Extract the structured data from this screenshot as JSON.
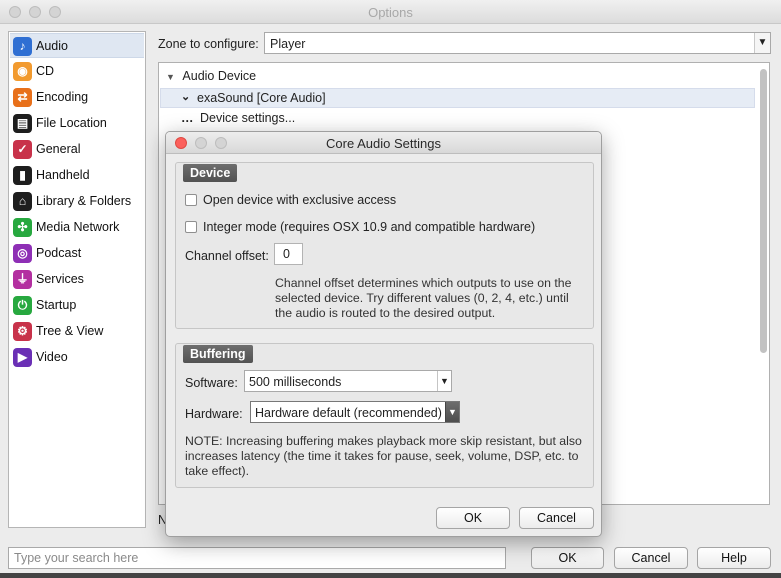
{
  "window": {
    "title": "Options"
  },
  "sidebar": {
    "items": [
      {
        "label": "Audio",
        "icon": "music-note-icon",
        "glyph": "♪",
        "color": "#2f6fd3",
        "selected": true
      },
      {
        "label": "CD",
        "icon": "cd-icon",
        "glyph": "◉",
        "color": "#f29a2e"
      },
      {
        "label": "Encoding",
        "icon": "encoding-arrows-icon",
        "glyph": "⇄",
        "color": "#e8701a"
      },
      {
        "label": "File Location",
        "icon": "file-location-icon",
        "glyph": "▤",
        "color": "#1e1e1e"
      },
      {
        "label": "General",
        "icon": "checkmark-icon",
        "glyph": "✓",
        "color": "#c8324a"
      },
      {
        "label": "Handheld",
        "icon": "handheld-icon",
        "glyph": "▮",
        "color": "#1e1e1e"
      },
      {
        "label": "Library & Folders",
        "icon": "library-house-icon",
        "glyph": "⌂",
        "color": "#1e1e1e"
      },
      {
        "label": "Media Network",
        "icon": "media-network-icon",
        "glyph": "✣",
        "color": "#27a83f"
      },
      {
        "label": "Podcast",
        "icon": "podcast-icon",
        "glyph": "◎",
        "color": "#8e2fb5"
      },
      {
        "label": "Services",
        "icon": "plug-icon",
        "glyph": "⏚",
        "color": "#b32fa0"
      },
      {
        "label": "Startup",
        "icon": "power-icon",
        "glyph": "⏻",
        "color": "#27a83f"
      },
      {
        "label": "Tree & View",
        "icon": "gear-icon",
        "glyph": "⚙",
        "color": "#c8324a"
      },
      {
        "label": "Video",
        "icon": "video-camera-icon",
        "glyph": "▶",
        "color": "#6a2fb5"
      }
    ]
  },
  "zone": {
    "label": "Zone to configure:",
    "value": "Player"
  },
  "tree": {
    "section": "Audio Device",
    "device": "exaSound [Core Audio]",
    "settings_link": "Device settings...",
    "clipped_text": "N"
  },
  "search": {
    "placeholder": "Type your search here"
  },
  "buttons": {
    "ok": "OK",
    "cancel": "Cancel",
    "help": "Help"
  },
  "dialog": {
    "title": "Core Audio Settings",
    "device_group": {
      "header": "Device",
      "exclusive_label": "Open device with exclusive access",
      "exclusive_checked": false,
      "integer_label": "Integer mode (requires OSX 10.9 and compatible hardware)",
      "integer_checked": false,
      "channel_offset_label": "Channel offset:",
      "channel_offset_value": "0",
      "help_line1": "Channel offset determines which outputs to use on the",
      "help_line2": "selected device.  Try different values (0, 2, 4, etc.) until",
      "help_line3": "the audio is routed to the desired output."
    },
    "buffering_group": {
      "header": "Buffering",
      "software_label": "Software:",
      "software_value": "500 milliseconds",
      "hardware_label": "Hardware:",
      "hardware_value": "Hardware default (recommended)",
      "note_line1": "NOTE: Increasing buffering makes playback more skip resistant, but also",
      "note_line2": "increases latency (the time it takes for pause, seek, volume, DSP, etc. to",
      "note_line3": "take effect)."
    },
    "ok": "OK",
    "cancel": "Cancel"
  }
}
